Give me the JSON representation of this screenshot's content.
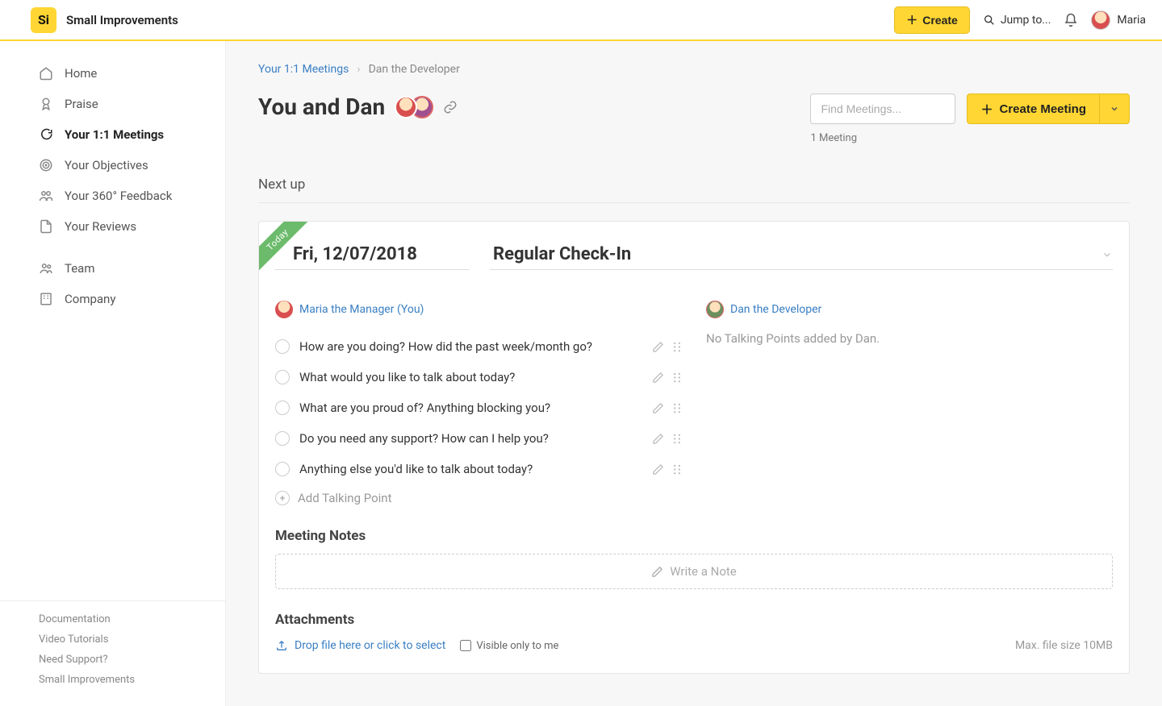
{
  "brand": {
    "logo_text": "Si",
    "name": "Small Improvements"
  },
  "header": {
    "create_label": "Create",
    "jump_label": "Jump to...",
    "user_name": "Maria"
  },
  "sidebar": {
    "items": [
      {
        "icon": "home",
        "label": "Home"
      },
      {
        "icon": "praise",
        "label": "Praise"
      },
      {
        "icon": "chat",
        "label": "Your 1:1 Meetings",
        "active": true
      },
      {
        "icon": "target",
        "label": "Your Objectives"
      },
      {
        "icon": "feedback",
        "label": "Your 360° Feedback"
      },
      {
        "icon": "doc",
        "label": "Your Reviews"
      },
      {
        "icon": "team",
        "label": "Team",
        "sep_before": true
      },
      {
        "icon": "company",
        "label": "Company"
      }
    ],
    "bottom_links": [
      "Documentation",
      "Video Tutorials",
      "Need Support?",
      "Small Improvements"
    ]
  },
  "breadcrumb": {
    "link": "Your 1:1 Meetings",
    "current": "Dan the Developer"
  },
  "page": {
    "title": "You and Dan",
    "find_placeholder": "Find Meetings...",
    "create_meeting_label": "Create Meeting",
    "meeting_count": "1 Meeting",
    "next_up_label": "Next up"
  },
  "meeting": {
    "ribbon": "Today",
    "date": "Fri, 12/07/2018",
    "subject": "Regular Check-In",
    "left": {
      "name": "Maria the Manager (You)",
      "talking_points": [
        "How are you doing? How did the past week/month go?",
        "What would you like to talk about today?",
        "What are you proud of? Anything blocking you?",
        "Do you need any support? How can I help you?",
        "Anything else you'd like to talk about today?"
      ],
      "add_label": "Add Talking Point"
    },
    "right": {
      "name": "Dan the Developer",
      "empty": "No Talking Points added by Dan."
    },
    "notes": {
      "title": "Meeting Notes",
      "placeholder": "Write a Note"
    },
    "attachments": {
      "title": "Attachments",
      "drop_label": "Drop file here or click to select",
      "visible_only_label": "Visible only to me",
      "max_size": "Max. file size 10MB"
    }
  }
}
